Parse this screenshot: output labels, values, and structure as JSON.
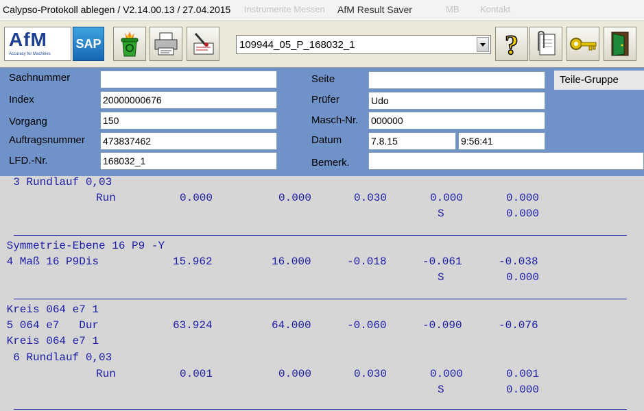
{
  "window": {
    "app_title": "Calypso-Protokoll ablegen  /  V2.14.00.13 / 27.04.2015",
    "dialog_title": "AfM Result Saver",
    "ghost_text_1": "Instrumente  Messen",
    "ghost_text_2": "MB",
    "ghost_text_3": "Kontakt"
  },
  "toolbar": {
    "logo_text": "AfM",
    "logo_subtext": "Accuracy for Machines",
    "sap_label": "SAP",
    "file_combo_value": "109944_05_P_168032_1"
  },
  "form": {
    "sachnummer_label": "Sachnummer",
    "sachnummer_value": "",
    "index_label": "Index",
    "index_value": "20000000676",
    "vorgang_label": "Vorgang",
    "vorgang_value": "150",
    "auftragsnummer_label": "Auftragsnummer",
    "auftragsnummer_value": "473837462",
    "lfd_label": "LFD.-Nr.",
    "lfd_value": "168032_1",
    "seite_label": "Seite",
    "seite_value": "",
    "pruefer_label": "Prüfer",
    "pruefer_value": "Udo",
    "masch_label": "Masch-Nr.",
    "masch_value": "000000",
    "datum_label": "Datum",
    "datum_value": "7.8.15",
    "zeit_value": "9:56:41",
    "bemerk_label": "Bemerk.",
    "bemerk_value": "",
    "teile_gruppe_label": "Teile-Gruppe"
  },
  "report": {
    "lines": [
      {
        "text": "  3 Rundlauf 0,03",
        "cells": []
      },
      {
        "text": "",
        "cells": [
          "Run",
          "0.000",
          "0.000",
          "0.030",
          "0.000",
          "0.000"
        ]
      },
      {
        "text": "",
        "cells": [
          "",
          "",
          "",
          "",
          "S",
          "0.000"
        ]
      },
      {
        "text": " Symmetrie-Ebene 16 P9 -Y",
        "cells": []
      },
      {
        "text": " 4 Maß 16 P9Dis",
        "cells": [
          "",
          "15.962",
          "16.000",
          "-0.018",
          "-0.061",
          "-0.038"
        ]
      },
      {
        "text": "",
        "cells": [
          "",
          "",
          "",
          "",
          "S",
          "0.000"
        ]
      },
      {
        "text": " Kreis 064 e7 1",
        "cells": []
      },
      {
        "text": " 5 064 e7   Dur",
        "cells": [
          "",
          "63.924",
          "64.000",
          "-0.060",
          "-0.090",
          "-0.076"
        ]
      },
      {
        "text": " Kreis 064 e7 1",
        "cells": []
      },
      {
        "text": "  6 Rundlauf 0,03",
        "cells": []
      },
      {
        "text": "",
        "cells": [
          "Run",
          "0.001",
          "0.000",
          "0.030",
          "0.000",
          "0.001"
        ]
      },
      {
        "text": "",
        "cells": [
          "",
          "",
          "",
          "",
          "S",
          "0.000"
        ]
      }
    ]
  },
  "colors": {
    "form_bg": "#6f93c9",
    "report_text": "#1a1aa8",
    "report_bg": "#d6d6d6"
  }
}
